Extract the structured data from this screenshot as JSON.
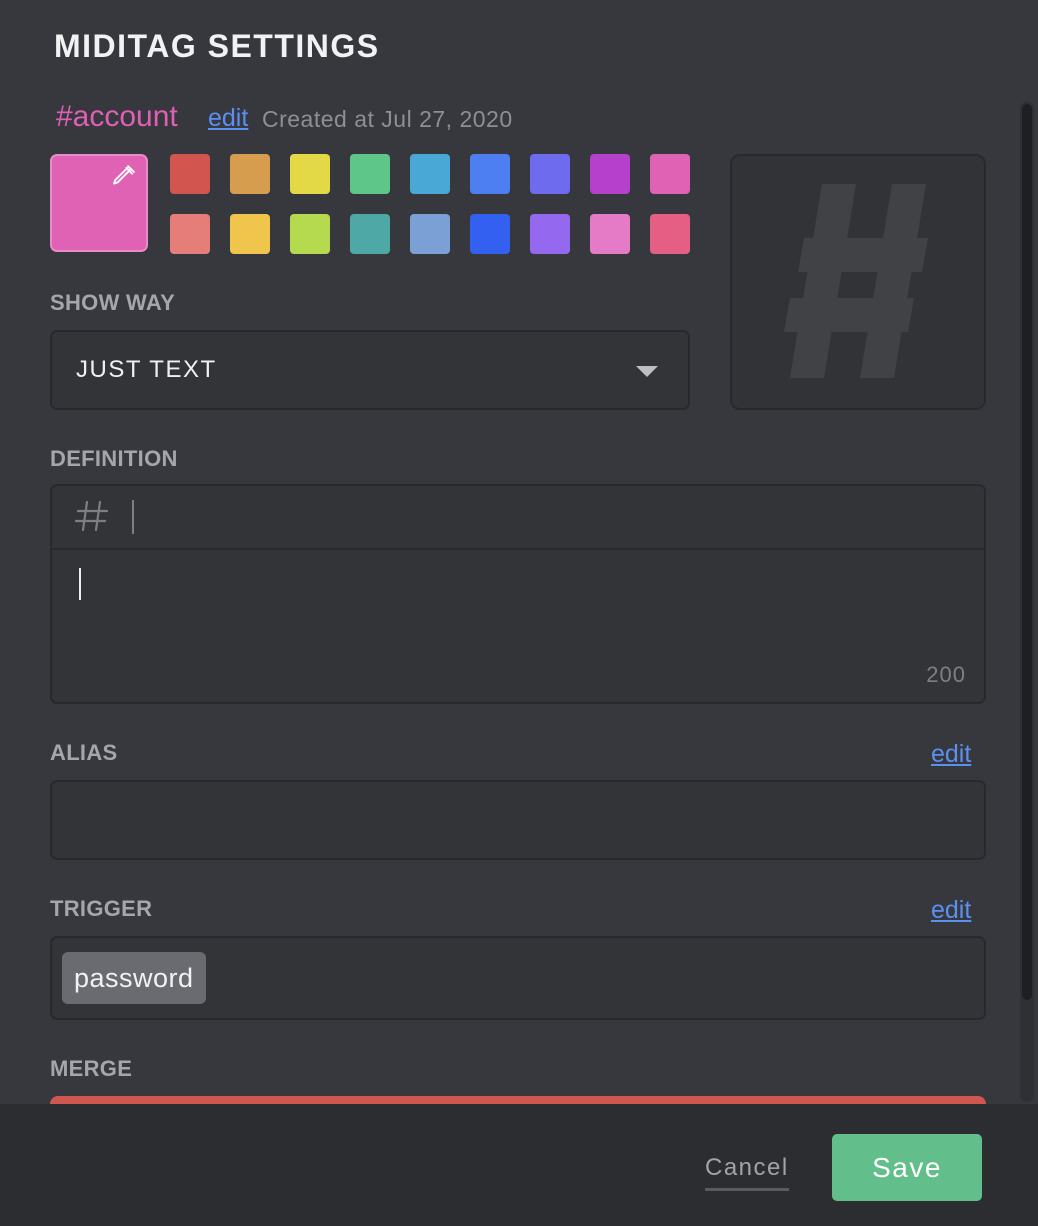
{
  "dialog": {
    "title": "MIDITAG SETTINGS"
  },
  "tag": {
    "name": "#account",
    "edit_label": "edit",
    "created_text": "Created at Jul 27, 2020",
    "selected_color": "#df62b4"
  },
  "palette": {
    "row1": [
      "#d35550",
      "#d79d4e",
      "#e3d946",
      "#5fc68a",
      "#4aa8d6",
      "#4e7ff2",
      "#6e6bef",
      "#b63fcb",
      "#df62b4"
    ],
    "row2": [
      "#e57d79",
      "#efc54b",
      "#b5d94f",
      "#4ea8a5",
      "#7aa0d6",
      "#3360f0",
      "#9468ef",
      "#e57bc6",
      "#e55f84"
    ]
  },
  "preview": {
    "icon": "hash-icon"
  },
  "show_way": {
    "label": "SHOW WAY",
    "value": "JUST TEXT"
  },
  "definition": {
    "label": "DEFINITION",
    "prefix_icon": "hash-icon",
    "counter": "200"
  },
  "alias": {
    "label": "ALIAS",
    "edit_label": "edit",
    "value": ""
  },
  "trigger": {
    "label": "TRIGGER",
    "edit_label": "edit",
    "chips": [
      "password"
    ]
  },
  "merge": {
    "label": "MERGE"
  },
  "footer": {
    "cancel_label": "Cancel",
    "save_label": "Save"
  }
}
